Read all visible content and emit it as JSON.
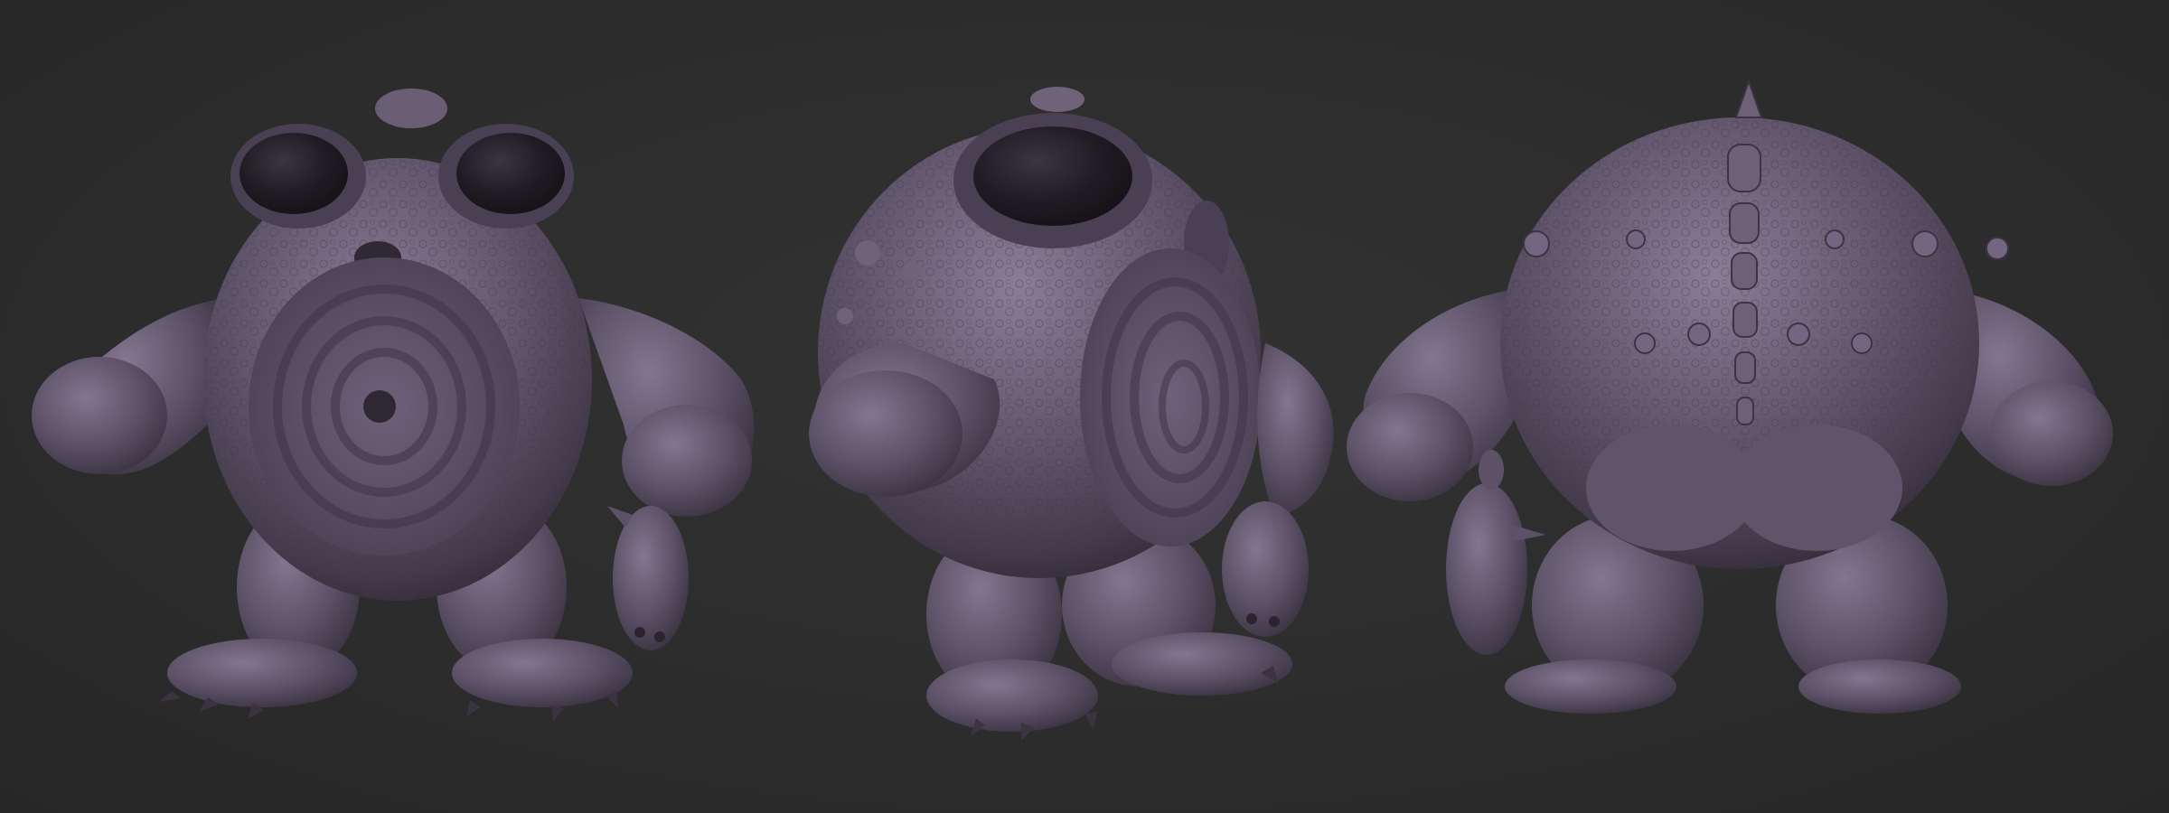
{
  "background_color": "#2d2d2d",
  "material_colors": {
    "clay_light": "#7d7088",
    "clay_mid": "#5e5368",
    "clay_dark": "#3a3241",
    "eye_dark": "#1e1b22"
  },
  "views": [
    {
      "view": "front"
    },
    {
      "view": "three-quarter"
    },
    {
      "view": "back"
    }
  ]
}
